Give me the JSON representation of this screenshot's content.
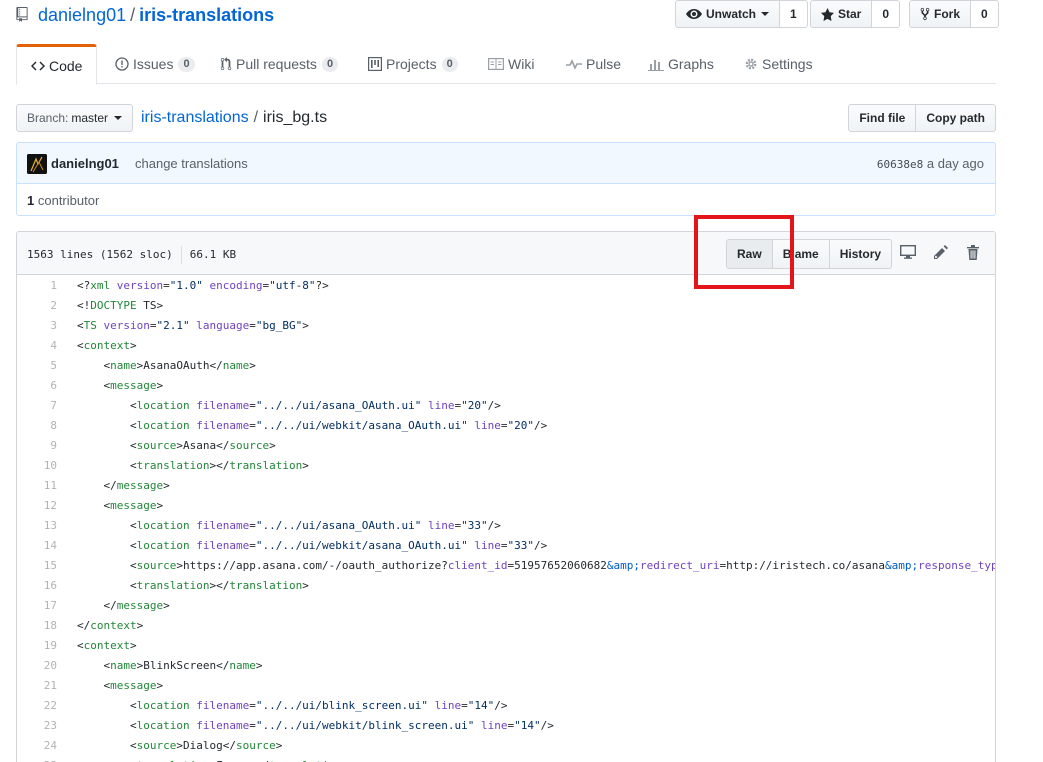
{
  "repo": {
    "owner": "danielng01",
    "separator": "/",
    "name": "iris-translations"
  },
  "actions": {
    "watch_label": "Unwatch",
    "watch_count": "1",
    "star_label": "Star",
    "star_count": "0",
    "fork_label": "Fork",
    "fork_count": "0"
  },
  "tabs": [
    {
      "label": "Code"
    },
    {
      "label": "Issues",
      "count": "0"
    },
    {
      "label": "Pull requests",
      "count": "0"
    },
    {
      "label": "Projects",
      "count": "0"
    },
    {
      "label": "Wiki"
    },
    {
      "label": "Pulse"
    },
    {
      "label": "Graphs"
    },
    {
      "label": "Settings"
    }
  ],
  "file_nav": {
    "branch_prefix": "Branch:",
    "branch": "master",
    "breadcrumb_root": "iris-translations",
    "breadcrumb_sep": "/",
    "filename": "iris_bg.ts",
    "find_file": "Find file",
    "copy_path": "Copy path"
  },
  "commit": {
    "author": "danielng01",
    "message": "change translations",
    "sha": "60638e8",
    "time": "a day ago"
  },
  "contributors": {
    "count": "1",
    "label": "contributor"
  },
  "file_header": {
    "lines": "1563 lines (1562 sloc)",
    "size": "66.1 KB",
    "raw": "Raw",
    "blame": "Blame",
    "history": "History"
  },
  "code_lines": [
    "<?xml version=\"1.0\" encoding=\"utf-8\"?>",
    "<!DOCTYPE TS>",
    "<TS version=\"2.1\" language=\"bg_BG\">",
    "<context>",
    "    <name>AsanaOAuth</name>",
    "    <message>",
    "        <location filename=\"../../ui/asana_OAuth.ui\" line=\"20\"/>",
    "        <location filename=\"../../ui/webkit/asana_OAuth.ui\" line=\"20\"/>",
    "        <source>Asana</source>",
    "        <translation></translation>",
    "    </message>",
    "    <message>",
    "        <location filename=\"../../ui/asana_OAuth.ui\" line=\"33\"/>",
    "        <location filename=\"../../ui/webkit/asana_OAuth.ui\" line=\"33\"/>",
    "        <source>https://app.asana.com/-/oauth_authorize?client_id=51957652060682&amp;redirect_uri=http://iristech.co/asana&amp;response_type=token</source>",
    "        <translation></translation>",
    "    </message>",
    "</context>",
    "<context>",
    "    <name>BlinkScreen</name>",
    "    <message>",
    "        <location filename=\"../../ui/blink_screen.ui\" line=\"14\"/>",
    "        <location filename=\"../../ui/webkit/blink_screen.ui\" line=\"14\"/>",
    "        <source>Dialog</source>",
    "        <translation>Диалог</translation>"
  ]
}
